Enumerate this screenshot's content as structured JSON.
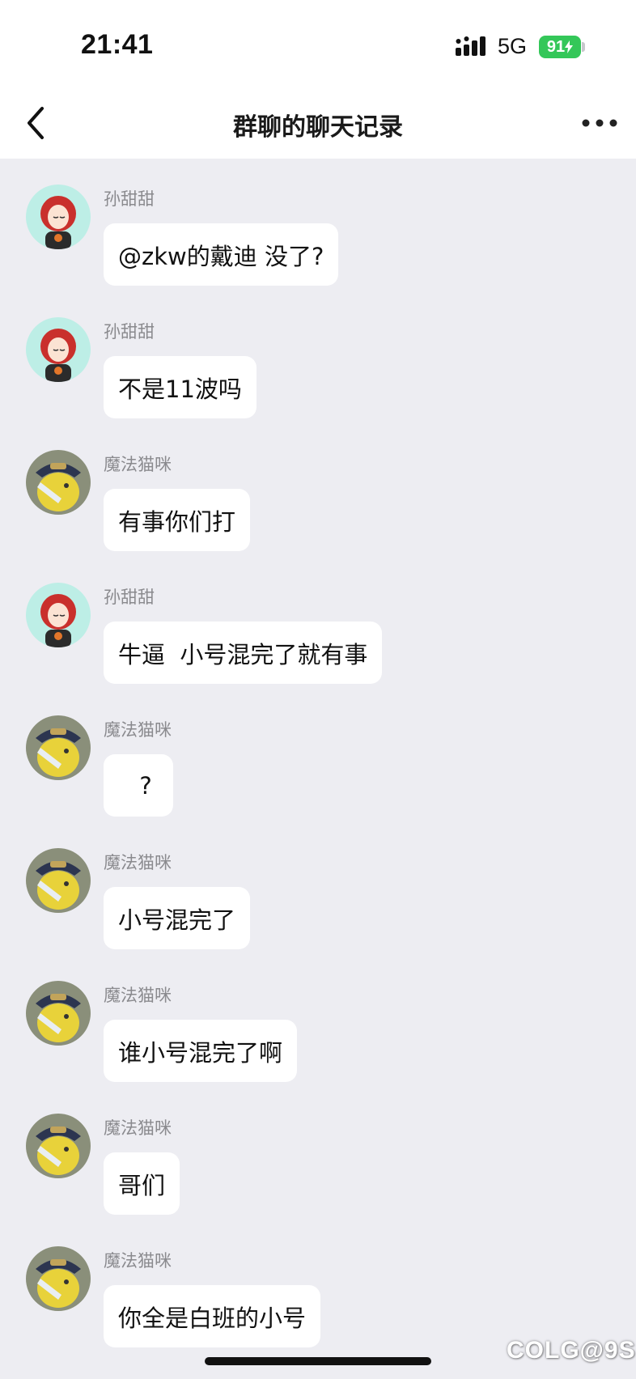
{
  "status_bar": {
    "time": "21:41",
    "network": "5G",
    "battery": "91",
    "signal_icon": "cellular-signal-icon",
    "battery_icon": "battery-charging-icon"
  },
  "nav": {
    "title": "群聊的聊天记录",
    "back_icon": "chevron-left-icon",
    "more_icon": "more-dots-icon"
  },
  "messages": [
    {
      "sender": "孙甜甜",
      "text": "@zkw的戴迪 没了?",
      "avatar": "red-hair-girl-avatar"
    },
    {
      "sender": "孙甜甜",
      "text": "不是11波吗",
      "avatar": "red-hair-girl-avatar"
    },
    {
      "sender": "魔法猫咪",
      "text": "有事你们打",
      "avatar": "yellow-hat-character-avatar"
    },
    {
      "sender": "孙甜甜",
      "text": "牛逼  小号混完了就有事",
      "avatar": "red-hair-girl-avatar"
    },
    {
      "sender": "魔法猫咪",
      "text": "  ?",
      "avatar": "yellow-hat-character-avatar"
    },
    {
      "sender": "魔法猫咪",
      "text": "小号混完了",
      "avatar": "yellow-hat-character-avatar"
    },
    {
      "sender": "魔法猫咪",
      "text": "谁小号混完了啊",
      "avatar": "yellow-hat-character-avatar"
    },
    {
      "sender": "魔法猫咪",
      "text": "哥们",
      "avatar": "yellow-hat-character-avatar"
    },
    {
      "sender": "魔法猫咪",
      "text": "你全是白班的小号",
      "avatar": "yellow-hat-character-avatar"
    }
  ],
  "watermark": "COLG@9S",
  "colors": {
    "background": "#ededf2",
    "bubble": "#ffffff",
    "battery": "#34c759",
    "sender_name": "#8a8a8e"
  }
}
